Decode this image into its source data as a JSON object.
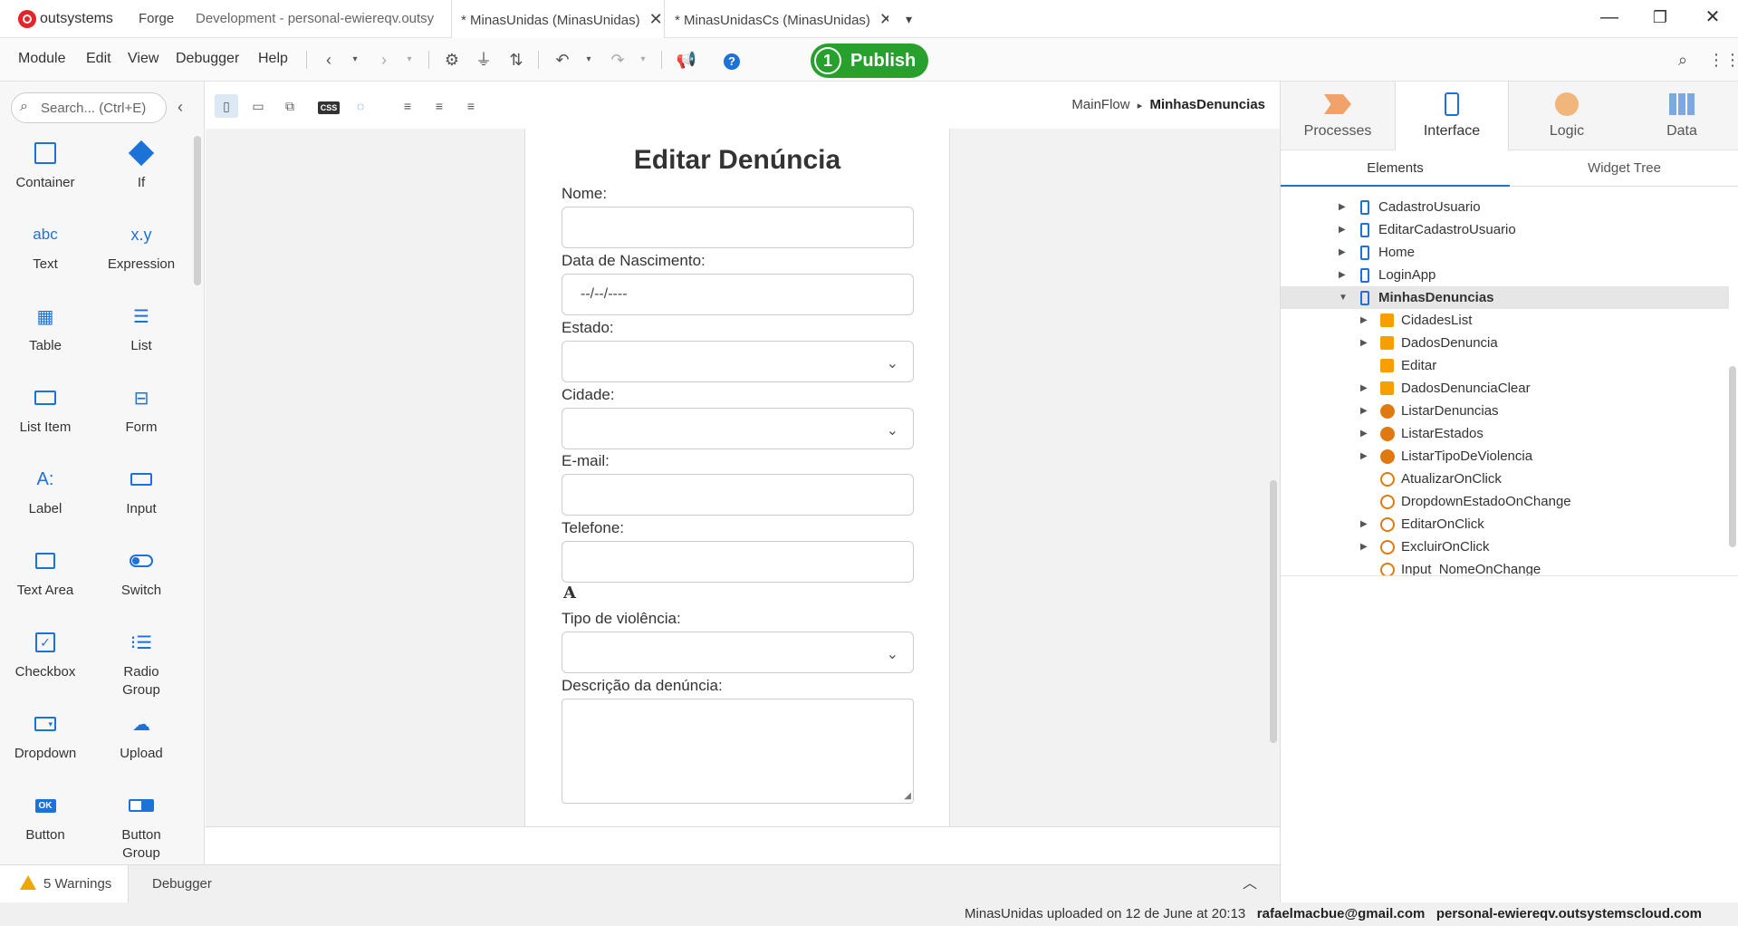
{
  "titlebar": {
    "brand": "outsystems",
    "tabs": [
      {
        "label": "Forge"
      },
      {
        "label": "Development - personal-ewiereqv.outsy"
      },
      {
        "label": "* MinasUnidas (MinasUnidas)"
      },
      {
        "label": "* MinasUnidasCs (MinasUnidas)"
      }
    ],
    "close_glyph": "✕",
    "overflow_glyph": "▾",
    "window": {
      "minimize": "—",
      "restore": "❐",
      "close": "✕"
    }
  },
  "menubar": {
    "items": [
      "Module",
      "Edit",
      "View",
      "Debugger",
      "Help"
    ],
    "publish": {
      "step": "1",
      "label": "Publish"
    }
  },
  "toolbox": {
    "search_placeholder": "Search... (Ctrl+E)",
    "widgets": [
      {
        "label": "Container",
        "icon": "container-icon"
      },
      {
        "label": "If",
        "icon": "if-icon"
      },
      {
        "label": "Text",
        "icon": "text-icon",
        "glyph": "abc"
      },
      {
        "label": "Expression",
        "icon": "expression-icon",
        "glyph": "x.y"
      },
      {
        "label": "Table",
        "icon": "table-icon"
      },
      {
        "label": "List",
        "icon": "list-icon"
      },
      {
        "label": "List Item",
        "icon": "list-item-icon"
      },
      {
        "label": "Form",
        "icon": "form-icon"
      },
      {
        "label": "Label",
        "icon": "label-icon",
        "glyph": "A:"
      },
      {
        "label": "Input",
        "icon": "input-icon"
      },
      {
        "label": "Text Area",
        "icon": "text-area-icon"
      },
      {
        "label": "Switch",
        "icon": "switch-icon"
      },
      {
        "label": "Checkbox",
        "icon": "checkbox-icon"
      },
      {
        "label": "Radio Group",
        "icon": "radio-group-icon"
      },
      {
        "label": "Dropdown",
        "icon": "dropdown-icon"
      },
      {
        "label": "Upload",
        "icon": "upload-icon"
      },
      {
        "label": "Button",
        "icon": "button-icon",
        "glyph": "OK"
      },
      {
        "label": "Button Group",
        "icon": "button-group-icon"
      }
    ]
  },
  "canvas_toolbar": {
    "css_label": "CSS",
    "breadcrumb": {
      "flow": "MainFlow",
      "separator": "▸",
      "screen": "MinhasDenuncias"
    }
  },
  "screen": {
    "title": "Editar Denúncia",
    "fields": {
      "nome": "Nome:",
      "nascimento": "Data de Nascimento:",
      "nascimento_value": "--/--/----",
      "estado": "Estado:",
      "cidade": "Cidade:",
      "email": "E-mail:",
      "telefone": "Telefone:",
      "glyph": "A",
      "tipo": "Tipo de violência:",
      "descricao": "Descrição da denúncia:"
    }
  },
  "right_panel": {
    "tabs": [
      {
        "label": "Processes"
      },
      {
        "label": "Interface"
      },
      {
        "label": "Logic"
      },
      {
        "label": "Data"
      }
    ],
    "subtabs": [
      "Elements",
      "Widget Tree"
    ],
    "tree": [
      {
        "label": "CadastroUsuario",
        "type": "screen"
      },
      {
        "label": "EditarCadastroUsuario",
        "type": "screen"
      },
      {
        "label": "Home",
        "type": "screen"
      },
      {
        "label": "LoginApp",
        "type": "screen"
      },
      {
        "label": "MinhasDenuncias",
        "type": "screen"
      },
      {
        "label": "CidadesList",
        "type": "var"
      },
      {
        "label": "DadosDenuncia",
        "type": "var"
      },
      {
        "label": "Editar",
        "type": "var"
      },
      {
        "label": "DadosDenunciaClear",
        "type": "var"
      },
      {
        "label": "ListarDenuncias",
        "type": "agg"
      },
      {
        "label": "ListarEstados",
        "type": "agg"
      },
      {
        "label": "ListarTipoDeViolencia",
        "type": "agg"
      },
      {
        "label": "AtualizarOnClick",
        "type": "act"
      },
      {
        "label": "DropdownEstadoOnChange",
        "type": "act"
      },
      {
        "label": "EditarOnClick",
        "type": "act"
      },
      {
        "label": "ExcluirOnClick",
        "type": "act"
      },
      {
        "label": "Input_NomeOnChange",
        "type": "act"
      }
    ]
  },
  "bottom": {
    "warnings": "5 Warnings",
    "debugger": "Debugger",
    "status_msg": "MinasUnidas uploaded on 12 de June at 20:13",
    "user": "rafaelmacbue@gmail.com",
    "server": "personal-ewiereqv.outsystemscloud.com"
  },
  "colors": {
    "accent": "#1d72d8",
    "publish": "#27a02e",
    "warning": "#f0a500",
    "logo": "#e5242a"
  }
}
